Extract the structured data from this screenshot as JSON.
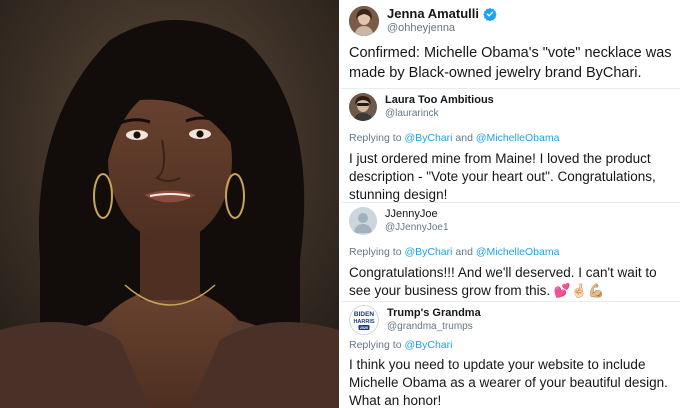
{
  "colors": {
    "link": "#1da1f2",
    "muted": "#657786",
    "text": "#14171a",
    "verified": "#1da1f2"
  },
  "main_tweet": {
    "display_name": "Jenna Amatulli",
    "handle": "@ohheyjenna",
    "verified": true,
    "text": "Confirmed: Michelle Obama's \"vote\" necklace was made by Black-owned jewelry brand ByChari."
  },
  "replies": [
    {
      "display_name": "Laura Too Ambitious",
      "handle": "@laurarinck",
      "replying_prefix": "Replying to",
      "mention_1": "@ByChari",
      "joiner": "and",
      "mention_2": "@MichelleObama",
      "text": "I just ordered mine from Maine! I loved the product description - \"Vote your heart out\". Congratulations, stunning design!"
    },
    {
      "display_name": "JJennyJoe",
      "handle": "@JJennyJoe1",
      "replying_prefix": "Replying to",
      "mention_1": "@ByChari",
      "joiner": "and",
      "mention_2": "@MichelleObama",
      "text": "Congratulations!!! And we'll deserved. I can't wait to see your business grow from this.",
      "emoji": "💕🤞🏻💪🏼"
    },
    {
      "display_name": "Trump's Grandma",
      "handle": "@grandma_trumps",
      "avatar_text": [
        "BIDEN",
        "HARRIS",
        "2020"
      ],
      "replying_prefix": "Replying to",
      "mention_1": "@ByChari",
      "text": "I think you need to update your website to include Michelle Obama as a wearer of your beautiful design. What an honor!"
    }
  ]
}
